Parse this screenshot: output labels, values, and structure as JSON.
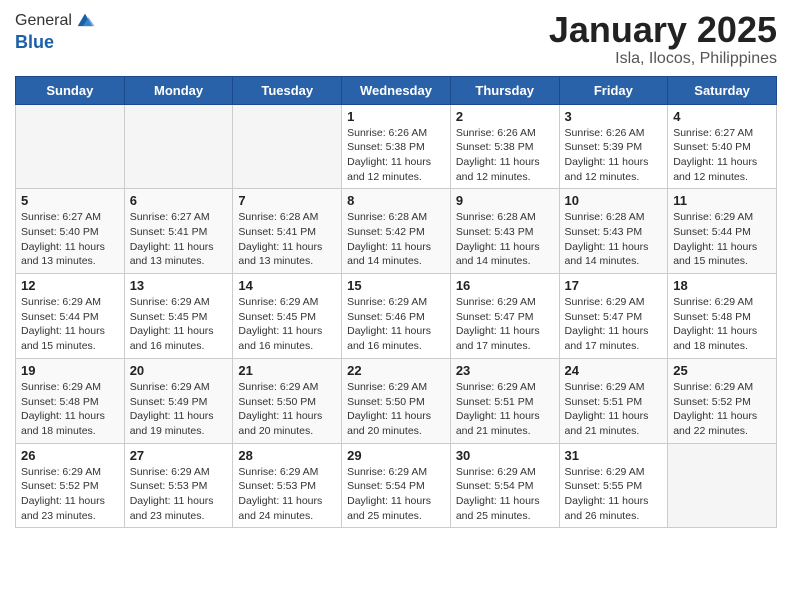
{
  "logo": {
    "general": "General",
    "blue": "Blue"
  },
  "title": "January 2025",
  "subtitle": "Isla, Ilocos, Philippines",
  "days_of_week": [
    "Sunday",
    "Monday",
    "Tuesday",
    "Wednesday",
    "Thursday",
    "Friday",
    "Saturday"
  ],
  "weeks": [
    [
      {
        "day": "",
        "sunrise": "",
        "sunset": "",
        "daylight": "",
        "empty": true
      },
      {
        "day": "",
        "sunrise": "",
        "sunset": "",
        "daylight": "",
        "empty": true
      },
      {
        "day": "",
        "sunrise": "",
        "sunset": "",
        "daylight": "",
        "empty": true
      },
      {
        "day": "1",
        "sunrise": "Sunrise: 6:26 AM",
        "sunset": "Sunset: 5:38 PM",
        "daylight": "Daylight: 11 hours and 12 minutes."
      },
      {
        "day": "2",
        "sunrise": "Sunrise: 6:26 AM",
        "sunset": "Sunset: 5:38 PM",
        "daylight": "Daylight: 11 hours and 12 minutes."
      },
      {
        "day": "3",
        "sunrise": "Sunrise: 6:26 AM",
        "sunset": "Sunset: 5:39 PM",
        "daylight": "Daylight: 11 hours and 12 minutes."
      },
      {
        "day": "4",
        "sunrise": "Sunrise: 6:27 AM",
        "sunset": "Sunset: 5:40 PM",
        "daylight": "Daylight: 11 hours and 12 minutes."
      }
    ],
    [
      {
        "day": "5",
        "sunrise": "Sunrise: 6:27 AM",
        "sunset": "Sunset: 5:40 PM",
        "daylight": "Daylight: 11 hours and 13 minutes."
      },
      {
        "day": "6",
        "sunrise": "Sunrise: 6:27 AM",
        "sunset": "Sunset: 5:41 PM",
        "daylight": "Daylight: 11 hours and 13 minutes."
      },
      {
        "day": "7",
        "sunrise": "Sunrise: 6:28 AM",
        "sunset": "Sunset: 5:41 PM",
        "daylight": "Daylight: 11 hours and 13 minutes."
      },
      {
        "day": "8",
        "sunrise": "Sunrise: 6:28 AM",
        "sunset": "Sunset: 5:42 PM",
        "daylight": "Daylight: 11 hours and 14 minutes."
      },
      {
        "day": "9",
        "sunrise": "Sunrise: 6:28 AM",
        "sunset": "Sunset: 5:43 PM",
        "daylight": "Daylight: 11 hours and 14 minutes."
      },
      {
        "day": "10",
        "sunrise": "Sunrise: 6:28 AM",
        "sunset": "Sunset: 5:43 PM",
        "daylight": "Daylight: 11 hours and 14 minutes."
      },
      {
        "day": "11",
        "sunrise": "Sunrise: 6:29 AM",
        "sunset": "Sunset: 5:44 PM",
        "daylight": "Daylight: 11 hours and 15 minutes."
      }
    ],
    [
      {
        "day": "12",
        "sunrise": "Sunrise: 6:29 AM",
        "sunset": "Sunset: 5:44 PM",
        "daylight": "Daylight: 11 hours and 15 minutes."
      },
      {
        "day": "13",
        "sunrise": "Sunrise: 6:29 AM",
        "sunset": "Sunset: 5:45 PM",
        "daylight": "Daylight: 11 hours and 16 minutes."
      },
      {
        "day": "14",
        "sunrise": "Sunrise: 6:29 AM",
        "sunset": "Sunset: 5:45 PM",
        "daylight": "Daylight: 11 hours and 16 minutes."
      },
      {
        "day": "15",
        "sunrise": "Sunrise: 6:29 AM",
        "sunset": "Sunset: 5:46 PM",
        "daylight": "Daylight: 11 hours and 16 minutes."
      },
      {
        "day": "16",
        "sunrise": "Sunrise: 6:29 AM",
        "sunset": "Sunset: 5:47 PM",
        "daylight": "Daylight: 11 hours and 17 minutes."
      },
      {
        "day": "17",
        "sunrise": "Sunrise: 6:29 AM",
        "sunset": "Sunset: 5:47 PM",
        "daylight": "Daylight: 11 hours and 17 minutes."
      },
      {
        "day": "18",
        "sunrise": "Sunrise: 6:29 AM",
        "sunset": "Sunset: 5:48 PM",
        "daylight": "Daylight: 11 hours and 18 minutes."
      }
    ],
    [
      {
        "day": "19",
        "sunrise": "Sunrise: 6:29 AM",
        "sunset": "Sunset: 5:48 PM",
        "daylight": "Daylight: 11 hours and 18 minutes."
      },
      {
        "day": "20",
        "sunrise": "Sunrise: 6:29 AM",
        "sunset": "Sunset: 5:49 PM",
        "daylight": "Daylight: 11 hours and 19 minutes."
      },
      {
        "day": "21",
        "sunrise": "Sunrise: 6:29 AM",
        "sunset": "Sunset: 5:50 PM",
        "daylight": "Daylight: 11 hours and 20 minutes."
      },
      {
        "day": "22",
        "sunrise": "Sunrise: 6:29 AM",
        "sunset": "Sunset: 5:50 PM",
        "daylight": "Daylight: 11 hours and 20 minutes."
      },
      {
        "day": "23",
        "sunrise": "Sunrise: 6:29 AM",
        "sunset": "Sunset: 5:51 PM",
        "daylight": "Daylight: 11 hours and 21 minutes."
      },
      {
        "day": "24",
        "sunrise": "Sunrise: 6:29 AM",
        "sunset": "Sunset: 5:51 PM",
        "daylight": "Daylight: 11 hours and 21 minutes."
      },
      {
        "day": "25",
        "sunrise": "Sunrise: 6:29 AM",
        "sunset": "Sunset: 5:52 PM",
        "daylight": "Daylight: 11 hours and 22 minutes."
      }
    ],
    [
      {
        "day": "26",
        "sunrise": "Sunrise: 6:29 AM",
        "sunset": "Sunset: 5:52 PM",
        "daylight": "Daylight: 11 hours and 23 minutes."
      },
      {
        "day": "27",
        "sunrise": "Sunrise: 6:29 AM",
        "sunset": "Sunset: 5:53 PM",
        "daylight": "Daylight: 11 hours and 23 minutes."
      },
      {
        "day": "28",
        "sunrise": "Sunrise: 6:29 AM",
        "sunset": "Sunset: 5:53 PM",
        "daylight": "Daylight: 11 hours and 24 minutes."
      },
      {
        "day": "29",
        "sunrise": "Sunrise: 6:29 AM",
        "sunset": "Sunset: 5:54 PM",
        "daylight": "Daylight: 11 hours and 25 minutes."
      },
      {
        "day": "30",
        "sunrise": "Sunrise: 6:29 AM",
        "sunset": "Sunset: 5:54 PM",
        "daylight": "Daylight: 11 hours and 25 minutes."
      },
      {
        "day": "31",
        "sunrise": "Sunrise: 6:29 AM",
        "sunset": "Sunset: 5:55 PM",
        "daylight": "Daylight: 11 hours and 26 minutes."
      },
      {
        "day": "",
        "sunrise": "",
        "sunset": "",
        "daylight": "",
        "empty": true
      }
    ]
  ]
}
